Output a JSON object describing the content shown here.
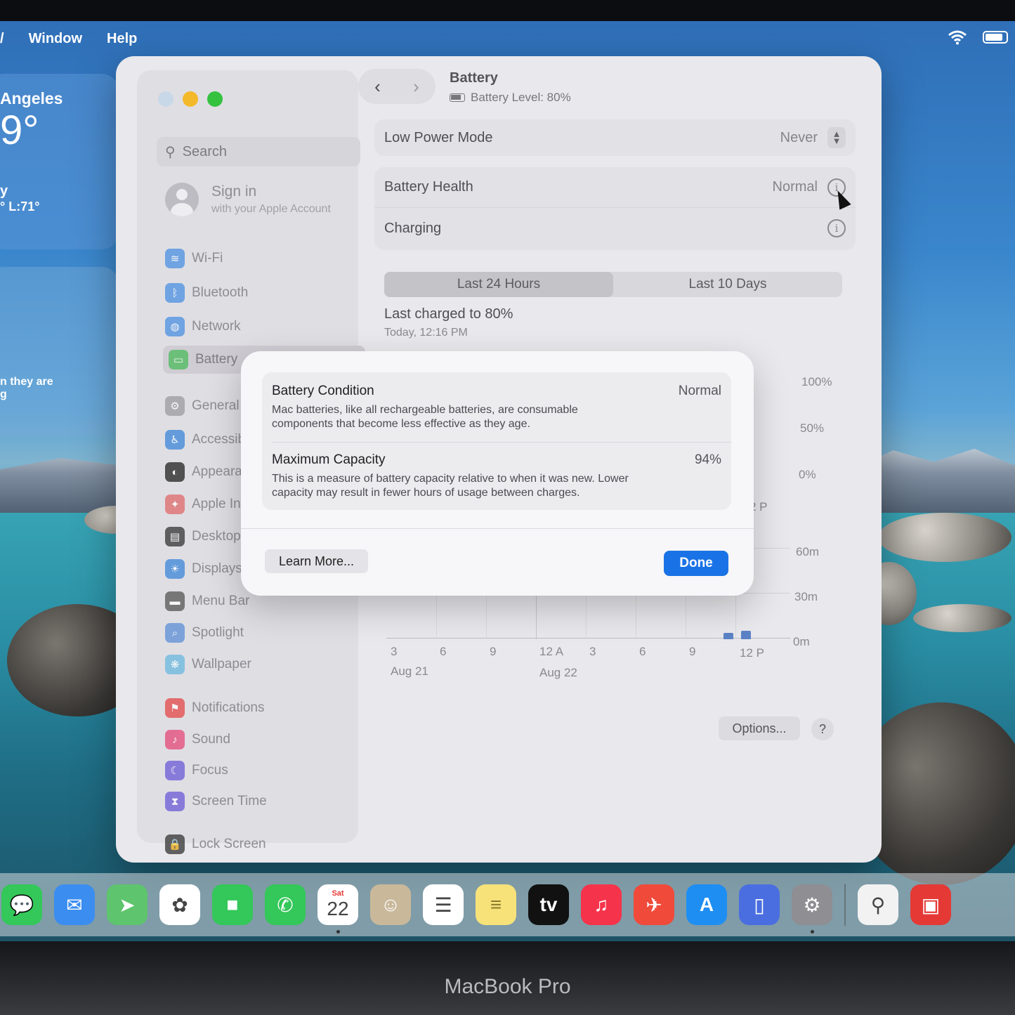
{
  "menubar": {
    "items": [
      "Window",
      "Help"
    ]
  },
  "weather": {
    "city": "Angeles",
    "temp": "9°",
    "cond": "y",
    "hl": "° L:71°",
    "note1": "n they are",
    "note2": "g"
  },
  "window": {
    "title": "Battery",
    "subtitle": "Battery Level: 80%",
    "search_placeholder": "Search",
    "signin_title": "Sign in",
    "signin_sub": "with your Apple Account",
    "sidebar": [
      {
        "label": "Wi-Fi",
        "color": "#4a90e2"
      },
      {
        "label": "Bluetooth",
        "color": "#4a90e2"
      },
      {
        "label": "Network",
        "color": "#4a90e2"
      },
      {
        "label": "Battery",
        "color": "#4cbb5a"
      },
      {
        "label": "General",
        "color": "#9a9aa0"
      },
      {
        "label": "Accessibil",
        "color": "#3b86d9"
      },
      {
        "label": "Appearanc",
        "color": "#222"
      },
      {
        "label": "Apple Inte",
        "color": "#e06a6a"
      },
      {
        "label": "Desktop &",
        "color": "#333"
      },
      {
        "label": "Displays",
        "color": "#3b86d9"
      },
      {
        "label": "Menu Bar",
        "color": "#555"
      },
      {
        "label": "Spotlight",
        "color": "#5b8fd6"
      },
      {
        "label": "Wallpaper",
        "color": "#6ab8e0"
      },
      {
        "label": "Notifications",
        "color": "#e54848"
      },
      {
        "label": "Sound",
        "color": "#e54878"
      },
      {
        "label": "Focus",
        "color": "#6a5ad8"
      },
      {
        "label": "Screen Time",
        "color": "#6a5ad8"
      },
      {
        "label": "Lock Screen",
        "color": "#333"
      }
    ],
    "low_power_label": "Low Power Mode",
    "low_power_value": "Never",
    "health_label": "Battery Health",
    "health_value": "Normal",
    "charging_label": "Charging",
    "tabs": [
      "Last 24 Hours",
      "Last 10 Days"
    ],
    "last_charged": "Last charged to 80%",
    "last_charged_time": "Today, 12:16 PM",
    "pct_labels": [
      "100%",
      "50%",
      "0%"
    ],
    "partial_tick": "2 P",
    "time_labels": [
      "60m",
      "30m",
      "0m"
    ],
    "x_ticks": [
      "3",
      "6",
      "9",
      "12 A",
      "3",
      "6",
      "9",
      "12 P"
    ],
    "x_dates": [
      "Aug 21",
      "Aug 22"
    ],
    "options_label": "Options...",
    "help_label": "?"
  },
  "sheet": {
    "condition_title": "Battery Condition",
    "condition_value": "Normal",
    "condition_desc": "Mac batteries, like all rechargeable batteries, are consumable components that become less effective as they age.",
    "capacity_title": "Maximum Capacity",
    "capacity_value": "94%",
    "capacity_desc": "This is a measure of battery capacity relative to when it was new. Lower capacity may result in fewer hours of usage between charges.",
    "learn_more": "Learn More...",
    "done": "Done"
  },
  "dock": [
    {
      "name": "messages",
      "bg": "#34c759",
      "glyph": "💬"
    },
    {
      "name": "mail",
      "bg": "#3b8df0",
      "glyph": "✉"
    },
    {
      "name": "maps",
      "bg": "#5ec46d",
      "glyph": "➤"
    },
    {
      "name": "photos",
      "bg": "#ffffff",
      "glyph": "✿"
    },
    {
      "name": "facetime",
      "bg": "#34c759",
      "glyph": "■"
    },
    {
      "name": "phone",
      "bg": "#34c759",
      "glyph": "✆"
    },
    {
      "name": "calendar",
      "bg": "#ffffff",
      "glyph": "22"
    },
    {
      "name": "contacts",
      "bg": "#c9b89a",
      "glyph": "☺"
    },
    {
      "name": "reminders",
      "bg": "#ffffff",
      "glyph": "☰"
    },
    {
      "name": "notes",
      "bg": "#f7e27a",
      "glyph": "≡"
    },
    {
      "name": "appletv",
      "bg": "#111111",
      "glyph": "tv"
    },
    {
      "name": "music",
      "bg": "#f5344b",
      "glyph": "♫"
    },
    {
      "name": "rocketsim",
      "bg": "#f04a3a",
      "glyph": "✈"
    },
    {
      "name": "appstore",
      "bg": "#1e8ef2",
      "glyph": "A"
    },
    {
      "name": "simulator",
      "bg": "#4a6ee0",
      "glyph": "▯"
    },
    {
      "name": "systemsettings",
      "bg": "#8e8e93",
      "glyph": "⚙"
    },
    {
      "name": "utility",
      "bg": "#f2f2f2",
      "glyph": "⚲"
    },
    {
      "name": "archive",
      "bg": "#e53935",
      "glyph": "▣"
    }
  ],
  "calendar_day": "Sat",
  "bezel": {
    "brand": "MacBook Pro"
  }
}
